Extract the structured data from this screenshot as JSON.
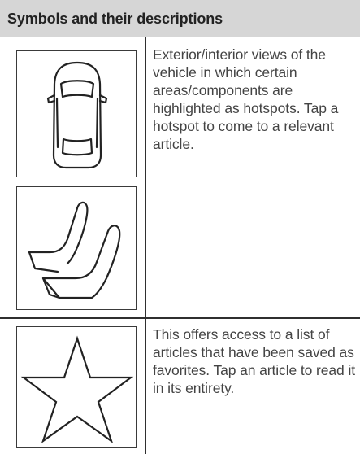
{
  "header": {
    "title": "Symbols and their descriptions"
  },
  "rows": [
    {
      "icons": [
        "car-top-view-icon",
        "car-seats-icon"
      ],
      "description": "Exterior/interior views of the vehicle in which certain areas/components are highlighted as hotspots. Tap a hotspot to come to a relevant article."
    },
    {
      "icons": [
        "star-favorites-icon"
      ],
      "description": "This offers access to a list of articles that have been saved as favorites. Tap an article to read it in its entirety."
    }
  ]
}
